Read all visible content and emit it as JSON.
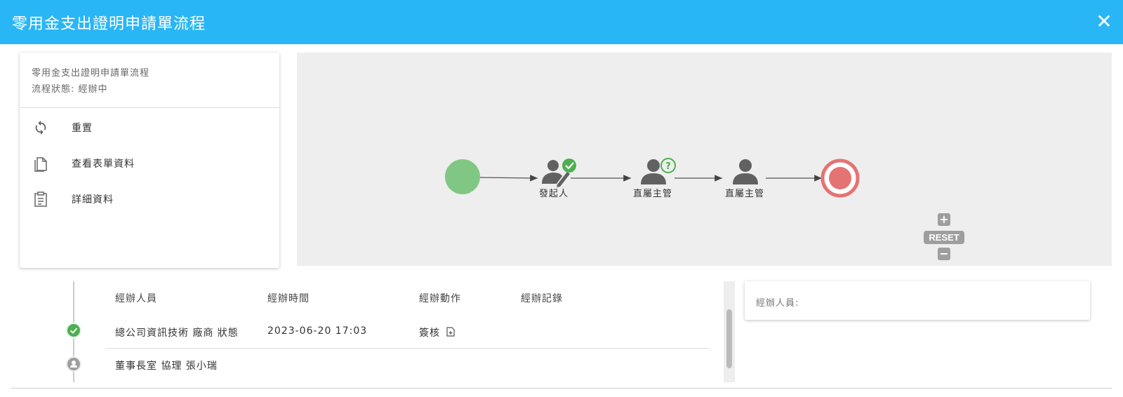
{
  "window": {
    "title": "零用金支出證明申請單流程",
    "close_icon": "close-icon"
  },
  "info_card": {
    "process_name": "零用金支出證明申請單流程",
    "status_line": "流程狀態: 經辦中",
    "menu": [
      {
        "label": "重置",
        "icon": "refresh-icon"
      },
      {
        "label": "查看表單資料",
        "icon": "document-icon"
      },
      {
        "label": "詳細資料",
        "icon": "clipboard-icon"
      }
    ]
  },
  "diagram": {
    "nodes": [
      {
        "label": "發起人",
        "state": "completed"
      },
      {
        "label": "直屬主管",
        "state": "pending"
      },
      {
        "label": "直屬主管",
        "state": "waiting"
      }
    ],
    "start_color": "#81c784",
    "end_color": "#e57373",
    "zoom": {
      "plus": "+",
      "reset": "RESET",
      "minus": "−"
    }
  },
  "history": {
    "headers": [
      "經辦人員",
      "經辦時間",
      "經辦動作",
      "經辦記錄"
    ],
    "rows": [
      {
        "handler": "總公司資訊技術 廠商 狀態",
        "time": "2023-06-20 17:03",
        "action": "簽核",
        "status": "done"
      },
      {
        "handler": "董事長室 協理 張小瑞",
        "time": "",
        "action": "",
        "status": "pending"
      }
    ]
  },
  "handler_panel": {
    "label": "經辦人員:"
  }
}
